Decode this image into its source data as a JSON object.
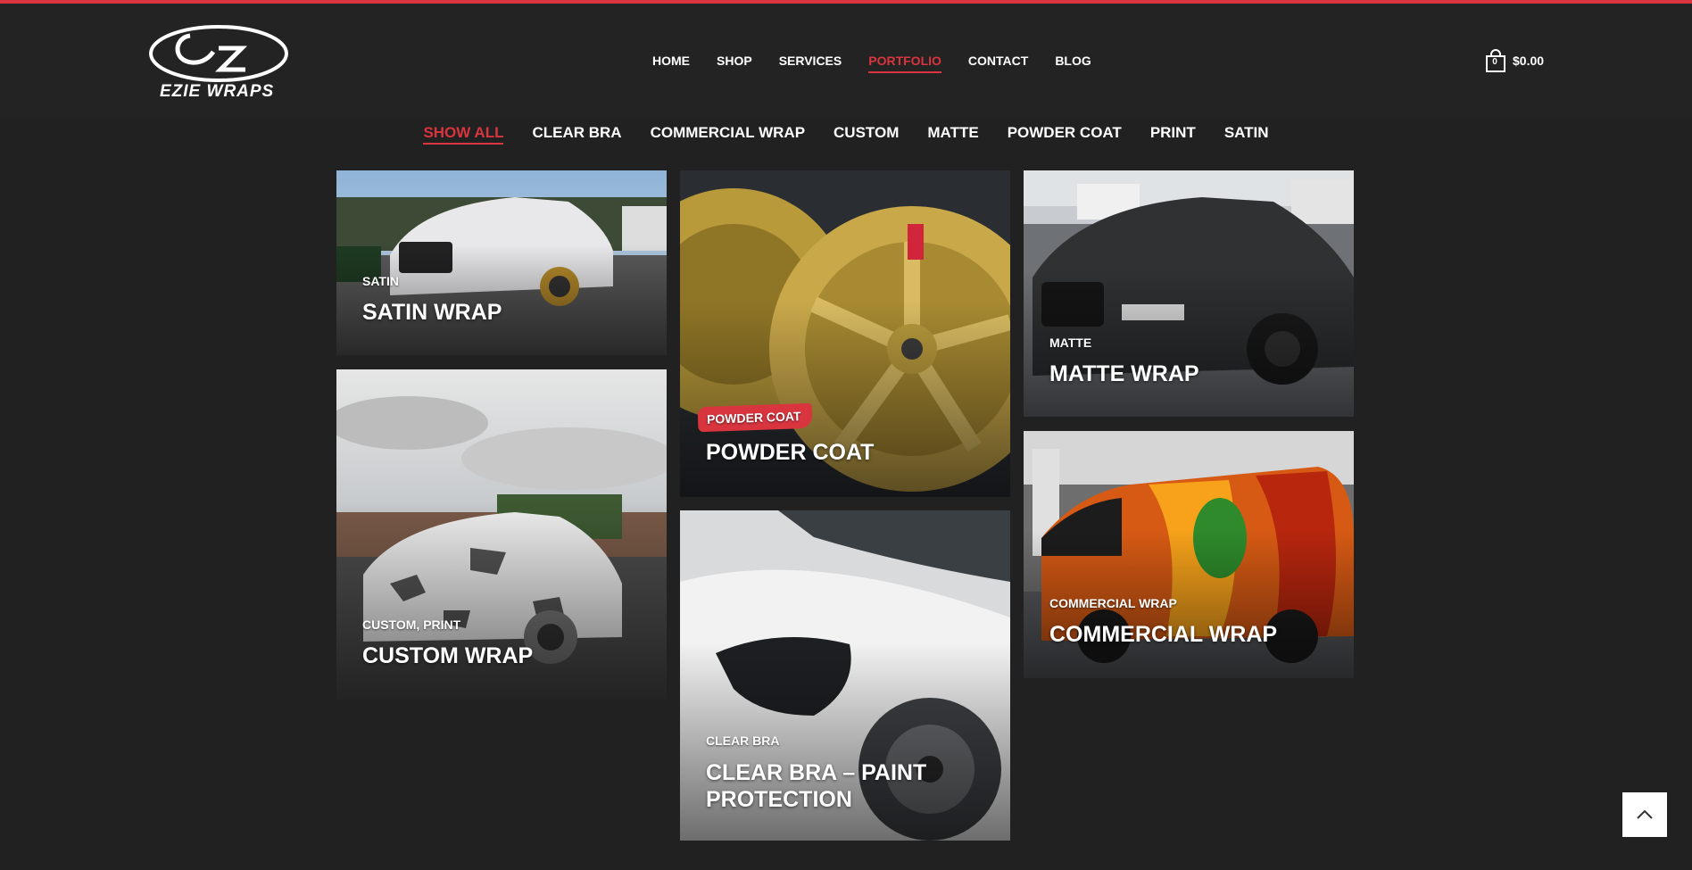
{
  "brand": {
    "name": "EZIE WRAPS",
    "accent": "#d9353f"
  },
  "nav": {
    "items": [
      {
        "label": "HOME",
        "active": false
      },
      {
        "label": "SHOP",
        "active": false
      },
      {
        "label": "SERVICES",
        "active": false
      },
      {
        "label": "PORTFOLIO",
        "active": true
      },
      {
        "label": "CONTACT",
        "active": false
      },
      {
        "label": "BLOG",
        "active": false
      }
    ]
  },
  "cart": {
    "count": "0",
    "total": "$0.00",
    "icon": "shopping-bag-icon"
  },
  "filters": [
    {
      "label": "SHOW ALL",
      "active": true
    },
    {
      "label": "CLEAR BRA",
      "active": false
    },
    {
      "label": "COMMERCIAL WRAP",
      "active": false
    },
    {
      "label": "CUSTOM",
      "active": false
    },
    {
      "label": "MATTE",
      "active": false
    },
    {
      "label": "POWDER COAT",
      "active": false
    },
    {
      "label": "PRINT",
      "active": false
    },
    {
      "label": "SATIN",
      "active": false
    }
  ],
  "portfolio": [
    {
      "category": "SATIN",
      "title": "SATIN WRAP"
    },
    {
      "category": "CUSTOM, PRINT",
      "title": "CUSTOM WRAP"
    },
    {
      "category": "POWDER COAT",
      "title": "POWDER COAT"
    },
    {
      "category": "CLEAR BRA",
      "title": "CLEAR BRA – PAINT PROTECTION"
    },
    {
      "category": "MATTE",
      "title": "MATTE WRAP"
    },
    {
      "category": "COMMERCIAL WRAP",
      "title": "COMMERCIAL WRAP"
    }
  ],
  "scroll_top": {
    "icon": "chevron-up-icon"
  }
}
